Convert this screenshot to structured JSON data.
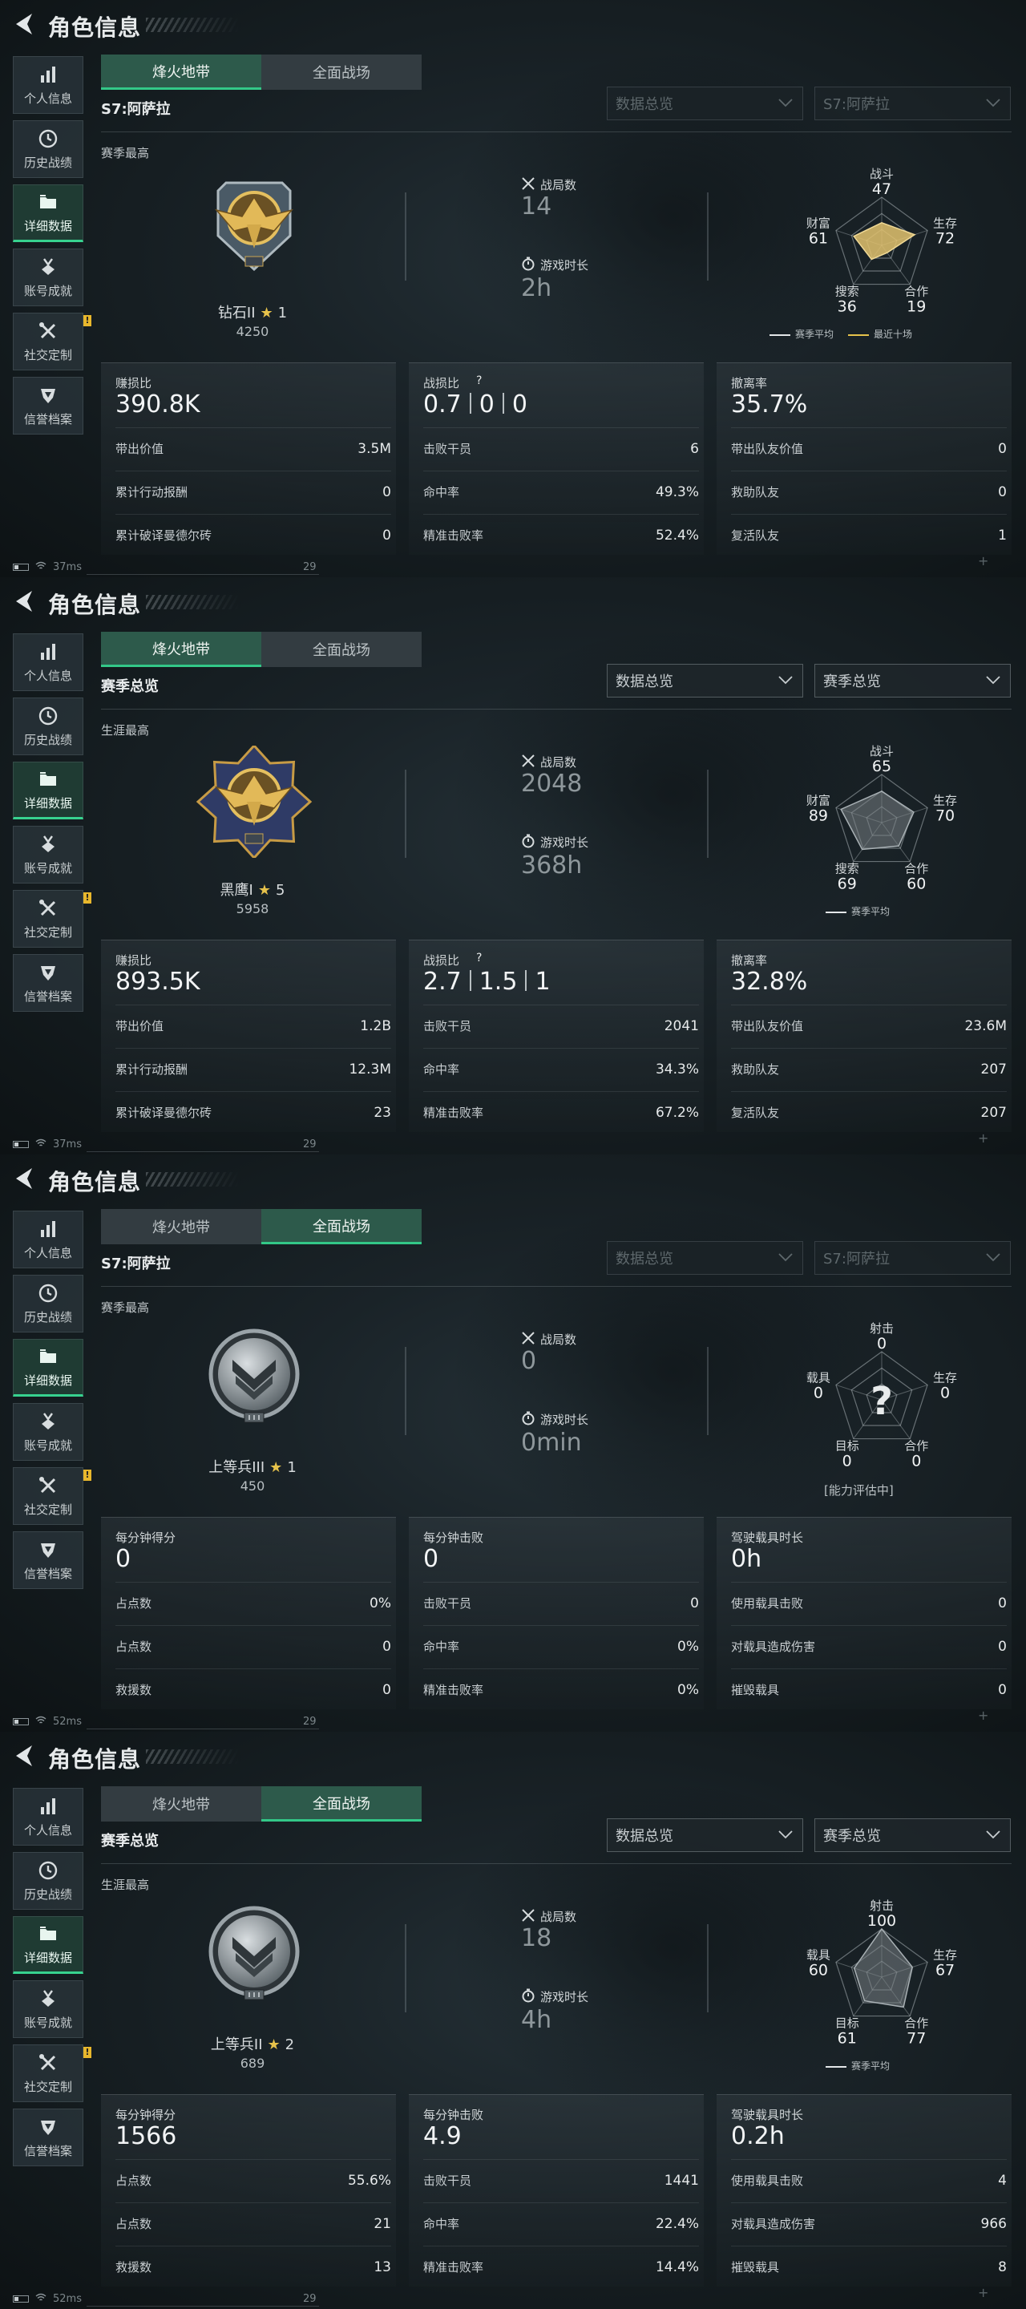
{
  "common": {
    "page_title": "角色信息",
    "sidebar": [
      {
        "label": "个人信息",
        "icon": "bar-chart-icon"
      },
      {
        "label": "历史战绩",
        "icon": "clock-icon"
      },
      {
        "label": "详细数据",
        "icon": "folder-icon"
      },
      {
        "label": "账号成就",
        "icon": "medal-icon"
      },
      {
        "label": "社交定制",
        "icon": "tools-icon"
      },
      {
        "label": "信誉档案",
        "icon": "shield-icon"
      }
    ],
    "tabs": [
      "烽火地带",
      "全面战场"
    ],
    "warn_badge": "!",
    "radar_legend_avg": "赛季平均",
    "radar_legend_recent": "最近十场",
    "battles_label": "战局数",
    "playtime_label": "游戏时长",
    "colors": {
      "accent": "#33c888",
      "radar_recent": "#e6c24b",
      "star": "#e6c24b"
    }
  },
  "panels": [
    {
      "active_tab": 0,
      "subhead": "S7:阿萨拉",
      "dropdown1": "数据总览",
      "dropdown2": "S7:阿萨拉",
      "dropdowns_dim": true,
      "best_label": "赛季最高",
      "rank_name": "钻石II",
      "rank_stars": "1",
      "rank_score": "4250",
      "emblem": "diamond-eagle-emblem",
      "battles": "14",
      "playtime": "2h",
      "radar": {
        "axes": [
          {
            "name": "战斗",
            "value": "47"
          },
          {
            "name": "生存",
            "value": "72"
          },
          {
            "name": "合作",
            "value": "19"
          },
          {
            "name": "搜索",
            "value": "36"
          },
          {
            "name": "财富",
            "value": "61"
          }
        ],
        "shape_values": [
          47,
          72,
          19,
          36,
          61
        ],
        "filled": "gold",
        "show_recent": true,
        "unknown": false,
        "note": ""
      },
      "cards": [
        {
          "head_label": "赚损比",
          "head_value": "390.8K",
          "rows": [
            {
              "k": "带出价值",
              "v": "3.5M"
            },
            {
              "k": "累计行动报酬",
              "v": "0"
            },
            {
              "k": "累计破译曼德尔砖",
              "v": "0"
            }
          ]
        },
        {
          "head_label": "战损比",
          "head_value": [
            "0.7",
            "0",
            "0"
          ],
          "help": "?",
          "rows": [
            {
              "k": "击败干员",
              "v": "6"
            },
            {
              "k": "命中率",
              "v": "49.3%"
            },
            {
              "k": "精准击败率",
              "v": "52.4%"
            }
          ]
        },
        {
          "head_label": "撤离率",
          "head_value": "35.7%",
          "rows": [
            {
              "k": "带出队友价值",
              "v": "0"
            },
            {
              "k": "救助队友",
              "v": "0"
            },
            {
              "k": "复活队友",
              "v": "1"
            }
          ]
        }
      ],
      "ping": "37ms",
      "fps": "29"
    },
    {
      "active_tab": 0,
      "subhead": "赛季总览",
      "dropdown1": "数据总览",
      "dropdown2": "赛季总览",
      "dropdowns_dim": false,
      "best_label": "生涯最高",
      "rank_name": "黑鹰I",
      "rank_stars": "5",
      "rank_score": "5958",
      "emblem": "blackhawk-emblem",
      "battles": "2048",
      "playtime": "368h",
      "radar": {
        "axes": [
          {
            "name": "战斗",
            "value": "65"
          },
          {
            "name": "生存",
            "value": "70"
          },
          {
            "name": "合作",
            "value": "60"
          },
          {
            "name": "搜索",
            "value": "69"
          },
          {
            "name": "财富",
            "value": "89"
          }
        ],
        "shape_values": [
          65,
          70,
          60,
          69,
          89
        ],
        "filled": "gray",
        "show_recent": false,
        "unknown": false,
        "note": ""
      },
      "cards": [
        {
          "head_label": "赚损比",
          "head_value": "893.5K",
          "rows": [
            {
              "k": "带出价值",
              "v": "1.2B"
            },
            {
              "k": "累计行动报酬",
              "v": "12.3M"
            },
            {
              "k": "累计破译曼德尔砖",
              "v": "23"
            }
          ]
        },
        {
          "head_label": "战损比",
          "head_value": [
            "2.7",
            "1.5",
            "1"
          ],
          "help": "?",
          "rows": [
            {
              "k": "击败干员",
              "v": "2041"
            },
            {
              "k": "命中率",
              "v": "34.3%"
            },
            {
              "k": "精准击败率",
              "v": "67.2%"
            }
          ]
        },
        {
          "head_label": "撤离率",
          "head_value": "32.8%",
          "rows": [
            {
              "k": "带出队友价值",
              "v": "23.6M"
            },
            {
              "k": "救助队友",
              "v": "207"
            },
            {
              "k": "复活队友",
              "v": "207"
            }
          ]
        }
      ],
      "ping": "37ms",
      "fps": "29"
    },
    {
      "active_tab": 1,
      "subhead": "S7:阿萨拉",
      "dropdown1": "数据总览",
      "dropdown2": "S7:阿萨拉",
      "dropdowns_dim": true,
      "best_label": "赛季最高",
      "rank_name": "上等兵III",
      "rank_stars": "1",
      "rank_score": "450",
      "emblem": "private-chevron-emblem",
      "battles": "0",
      "playtime": "0min",
      "radar": {
        "axes": [
          {
            "name": "射击",
            "value": "0"
          },
          {
            "name": "生存",
            "value": "0"
          },
          {
            "name": "合作",
            "value": "0"
          },
          {
            "name": "目标",
            "value": "0"
          },
          {
            "name": "载具",
            "value": "0"
          }
        ],
        "shape_values": [
          0,
          0,
          0,
          0,
          0
        ],
        "filled": "none",
        "show_recent": false,
        "unknown": true,
        "unknown_mark": "?",
        "note": "[能力评估中]"
      },
      "cards": [
        {
          "head_label": "每分钟得分",
          "head_value": "0",
          "rows": [
            {
              "k": "占点数",
              "v": "0%"
            },
            {
              "k": "占点数",
              "v": "0"
            },
            {
              "k": "救援数",
              "v": "0"
            }
          ]
        },
        {
          "head_label": "每分钟击败",
          "head_value": "0",
          "rows": [
            {
              "k": "击败干员",
              "v": "0"
            },
            {
              "k": "命中率",
              "v": "0%"
            },
            {
              "k": "精准击败率",
              "v": "0%"
            }
          ]
        },
        {
          "head_label": "驾驶载具时长",
          "head_value": "0h",
          "rows": [
            {
              "k": "使用载具击败",
              "v": "0"
            },
            {
              "k": "对载具造成伤害",
              "v": "0"
            },
            {
              "k": "摧毁载具",
              "v": "0"
            }
          ]
        }
      ],
      "ping": "52ms",
      "fps": "29"
    },
    {
      "active_tab": 1,
      "subhead": "赛季总览",
      "dropdown1": "数据总览",
      "dropdown2": "赛季总览",
      "dropdowns_dim": false,
      "best_label": "生涯最高",
      "rank_name": "上等兵II",
      "rank_stars": "2",
      "rank_score": "689",
      "emblem": "private-chevron-emblem",
      "battles": "18",
      "playtime": "4h",
      "radar": {
        "axes": [
          {
            "name": "射击",
            "value": "100"
          },
          {
            "name": "生存",
            "value": "67"
          },
          {
            "name": "合作",
            "value": "77"
          },
          {
            "name": "目标",
            "value": "61"
          },
          {
            "name": "载具",
            "value": "60"
          }
        ],
        "shape_values": [
          100,
          67,
          77,
          61,
          60
        ],
        "filled": "gray",
        "show_recent": false,
        "unknown": false,
        "note": ""
      },
      "cards": [
        {
          "head_label": "每分钟得分",
          "head_value": "1566",
          "rows": [
            {
              "k": "占点数",
              "v": "55.6%"
            },
            {
              "k": "占点数",
              "v": "21"
            },
            {
              "k": "救援数",
              "v": "13"
            }
          ]
        },
        {
          "head_label": "每分钟击败",
          "head_value": "4.9",
          "rows": [
            {
              "k": "击败干员",
              "v": "1441"
            },
            {
              "k": "命中率",
              "v": "22.4%"
            },
            {
              "k": "精准击败率",
              "v": "14.4%"
            }
          ]
        },
        {
          "head_label": "驾驶载具时长",
          "head_value": "0.2h",
          "rows": [
            {
              "k": "使用载具击败",
              "v": "4"
            },
            {
              "k": "对载具造成伤害",
              "v": "966"
            },
            {
              "k": "摧毁载具",
              "v": "8"
            }
          ]
        }
      ],
      "ping": "52ms",
      "fps": "29"
    }
  ]
}
